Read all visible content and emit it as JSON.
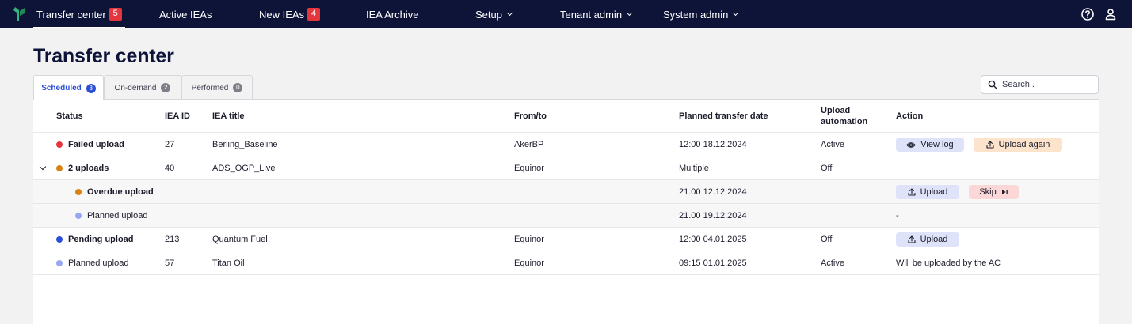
{
  "nav": {
    "items": [
      {
        "label": "Transfer center",
        "badge": "5"
      },
      {
        "label": "Active IEAs"
      },
      {
        "label": "New IEAs",
        "badge": "4"
      },
      {
        "label": "IEA Archive"
      },
      {
        "label": "Setup"
      },
      {
        "label": "Tenant admin"
      },
      {
        "label": "System admin"
      }
    ],
    "icons": [
      "help-icon",
      "user-icon"
    ]
  },
  "page": {
    "title": "Transfer center"
  },
  "tabs": [
    {
      "label": "Scheduled",
      "count": "3"
    },
    {
      "label": "On-demand",
      "count": "2"
    },
    {
      "label": "Performed",
      "count": "0"
    }
  ],
  "search": {
    "placeholder": "Search.."
  },
  "table": {
    "headers": {
      "status": "Status",
      "iea_id": "IEA ID",
      "iea_title": "IEA title",
      "from_to": "From/to",
      "planned": "Planned transfer date",
      "upload_auto_1": "Upload",
      "upload_auto_2": "automation",
      "action": "Action"
    },
    "rows": [
      {
        "status": "Failed upload",
        "id": "27",
        "title": "Berling_Baseline",
        "from_to": "AkerBP",
        "date": "12:00 18.12.2024",
        "automation": "Active",
        "actions": [
          "View log",
          "Upload again"
        ]
      },
      {
        "status": "2 uploads",
        "id": "40",
        "title": "ADS_OGP_Live",
        "from_to": "Equinor",
        "date": "Multiple",
        "automation": "Off"
      },
      {
        "status": "Overdue upload",
        "date": "21.00 12.12.2024",
        "actions": [
          "Upload",
          "Skip"
        ]
      },
      {
        "status": "Planned upload",
        "date": "21.00 19.12.2024",
        "action_text": "-"
      },
      {
        "status": "Pending upload",
        "id": "213",
        "title": "Quantum Fuel",
        "from_to": "Equinor",
        "date": "12:00 04.01.2025",
        "automation": "Off",
        "actions": [
          "Upload"
        ]
      },
      {
        "status": "Planned upload",
        "id": "57",
        "title": "Titan Oil",
        "from_to": "Equinor",
        "date": "09:15 01.01.2025",
        "automation": "Active",
        "action_text": "Will be uploaded by the AC"
      }
    ]
  },
  "colors": {
    "nav_bg": "#0d1438",
    "failed": "#e5363d",
    "overdue": "#d98212",
    "pending": "#2b4fd6",
    "planned": "#97a7f2",
    "accent": "#2b4fd6"
  }
}
